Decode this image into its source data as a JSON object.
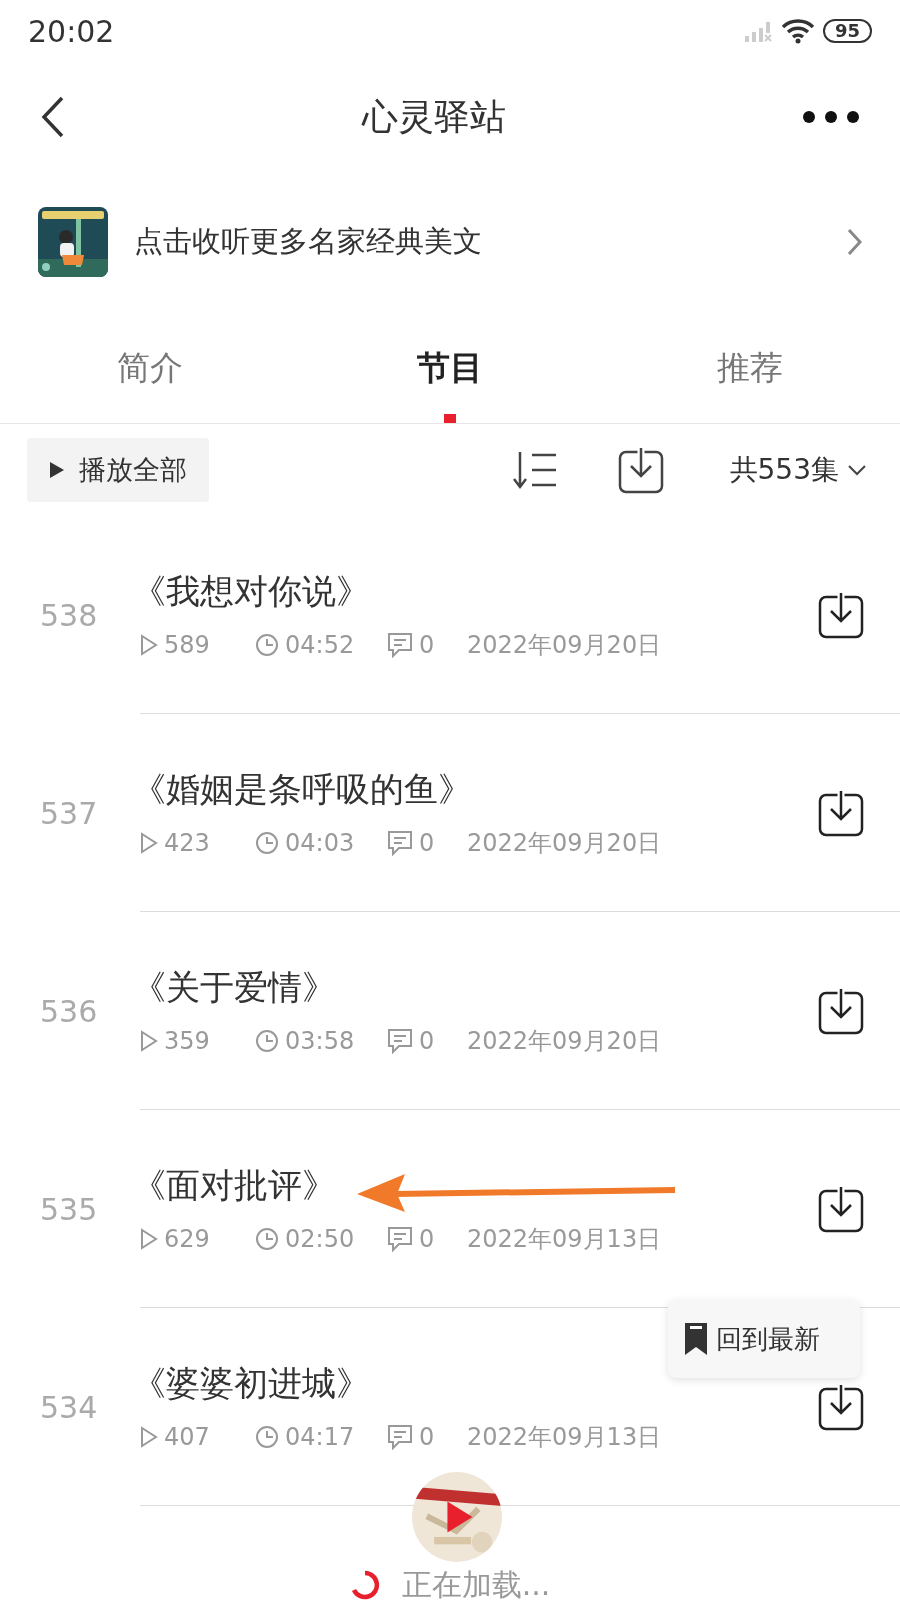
{
  "status_bar": {
    "time": "20:02",
    "battery": "95"
  },
  "header": {
    "title": "心灵驿站"
  },
  "banner": {
    "text": "点击收听更多名家经典美文"
  },
  "tabs": [
    {
      "label": "简介",
      "selected": false
    },
    {
      "label": "节目",
      "selected": true
    },
    {
      "label": "推荐",
      "selected": false
    }
  ],
  "toolbar": {
    "play_all": "播放全部",
    "total": "共553集"
  },
  "episodes": [
    {
      "number": "538",
      "title": "《我想对你说》",
      "plays": "589",
      "duration": "04:52",
      "comments": "0",
      "date": "2022年09月20日"
    },
    {
      "number": "537",
      "title": "《婚姻是条呼吸的鱼》",
      "plays": "423",
      "duration": "04:03",
      "comments": "0",
      "date": "2022年09月20日"
    },
    {
      "number": "536",
      "title": "《关于爱情》",
      "plays": "359",
      "duration": "03:58",
      "comments": "0",
      "date": "2022年09月20日"
    },
    {
      "number": "535",
      "title": "《面对批评》",
      "plays": "629",
      "duration": "02:50",
      "comments": "0",
      "date": "2022年09月13日"
    },
    {
      "number": "534",
      "title": "《婆婆初进城》",
      "plays": "407",
      "duration": "04:17",
      "comments": "0",
      "date": "2022年09月13日"
    }
  ],
  "back_to_latest": {
    "label": "回到最新"
  },
  "loading": {
    "text": "正在加载..."
  }
}
